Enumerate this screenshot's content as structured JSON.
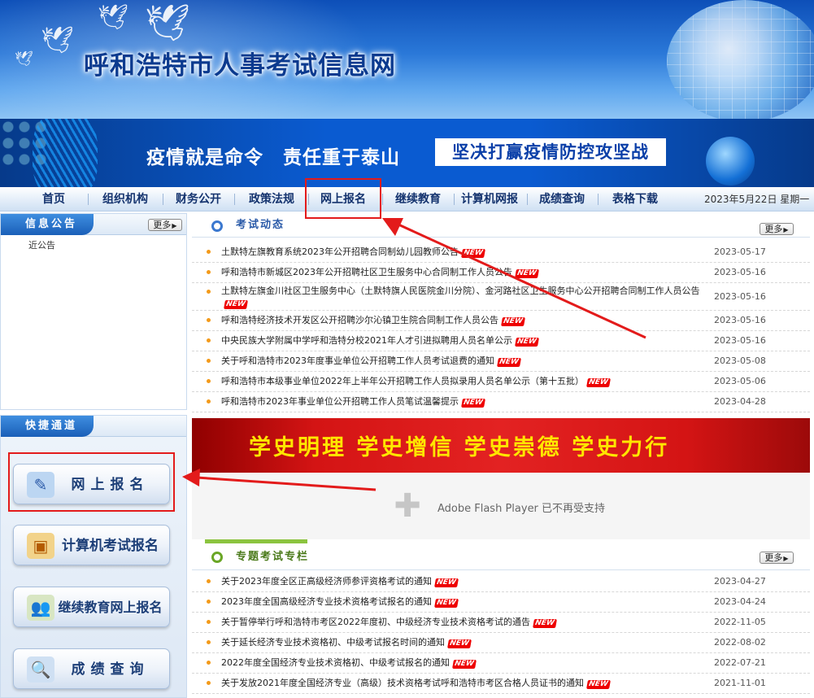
{
  "header": {
    "site_title": "呼和浩特市人事考试信息网",
    "slogan_left": "疫情就是命令　责任重于泰山",
    "slogan_right": "坚决打赢疫情防控攻坚战"
  },
  "nav": {
    "items": [
      "首页",
      "组织机构",
      "财务公开",
      "政策法规",
      "网上报名",
      "继续教育",
      "计算机网报",
      "成绩查询",
      "表格下载"
    ],
    "date": "2023年5月22日 星期一"
  },
  "info_notice": {
    "title": "信息公告",
    "more": "更多",
    "snippet": "近公告"
  },
  "quick": {
    "title": "快捷通道",
    "buttons": [
      "网上报名",
      "计算机考试报名",
      "继续教育网上报名",
      "成绩查询"
    ]
  },
  "exam_news": {
    "title": "考试动态",
    "more": "更多",
    "new_label": "NEW",
    "items": [
      {
        "text": "土默特左旗教育系统2023年公开招聘合同制幼儿园教师公告",
        "date": "2023-05-17"
      },
      {
        "text": "呼和浩特市新城区2023年公开招聘社区卫生服务中心合同制工作人员公告",
        "date": "2023-05-16"
      },
      {
        "text": "土默特左旗金川社区卫生服务中心（土默特旗人民医院金川分院）、金河路社区卫生服务中心公开招聘合同制工作人员公告",
        "date": "2023-05-16"
      },
      {
        "text": "呼和浩特经济技术开发区公开招聘沙尔沁镇卫生院合同制工作人员公告",
        "date": "2023-05-16"
      },
      {
        "text": "中央民族大学附属中学呼和浩特分校2021年人才引进拟聘用人员名单公示",
        "date": "2023-05-16"
      },
      {
        "text": "关于呼和浩特市2023年度事业单位公开招聘工作人员考试退费的通知",
        "date": "2023-05-08"
      },
      {
        "text": "呼和浩特市本级事业单位2022年上半年公开招聘工作人员拟录用人员名单公示（第十五批）",
        "date": "2023-05-06"
      },
      {
        "text": "呼和浩特市2023年事业单位公开招聘工作人员笔试温馨提示",
        "date": "2023-04-28"
      }
    ]
  },
  "red_banner": {
    "text": "学史明理 学史增信 学史崇德 学史力行"
  },
  "flash": {
    "text": "Adobe Flash Player 已不再受支持"
  },
  "special": {
    "title": "专题考试专栏",
    "more": "更多",
    "items": [
      {
        "text": "关于2023年度全区正高级经济师参评资格考试的通知",
        "date": "2023-04-27"
      },
      {
        "text": "2023年度全国高级经济专业技术资格考试报名的通知",
        "date": "2023-04-24"
      },
      {
        "text": "关于暂停举行呼和浩特市考区2022年度初、中级经济专业技术资格考试的通告",
        "date": "2022-11-05"
      },
      {
        "text": "关于延长经济专业技术资格初、中级考试报名时间的通知",
        "date": "2022-08-02"
      },
      {
        "text": "2022年度全国经济专业技术资格初、中级考试报名的通知",
        "date": "2022-07-21"
      },
      {
        "text": "关于发放2021年度全国经济专业（高级）技术资格考试呼和浩特市考区合格人员证书的通知",
        "date": "2021-11-01"
      }
    ]
  },
  "colors": {
    "annotation_red": "#e31b1b",
    "nav_text": "#14336e",
    "bullet": "#f39a1a"
  }
}
